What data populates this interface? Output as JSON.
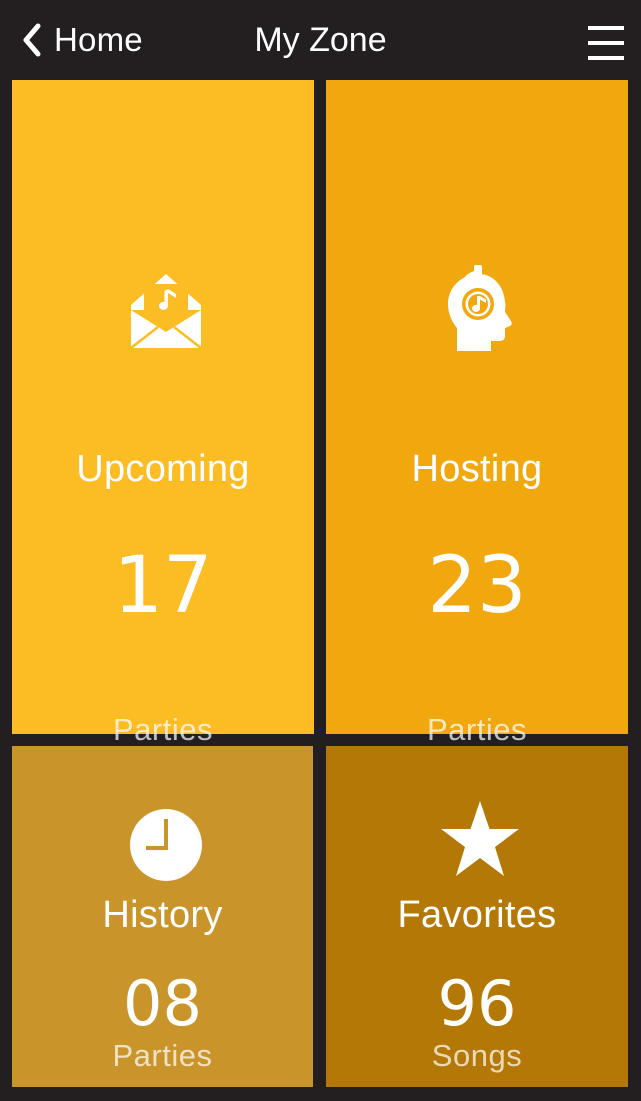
{
  "header": {
    "back_label": "Home",
    "title": "My Zone",
    "back_icon": "chevron-left-icon",
    "menu_icon": "hamburger-menu-icon"
  },
  "tiles": {
    "upcoming": {
      "label": "Upcoming",
      "count": "17",
      "unit": "Parties",
      "icon": "music-envelope-icon",
      "color": "#fcbc24"
    },
    "hosting": {
      "label": "Hosting",
      "count": "23",
      "unit": "Parties",
      "icon": "head-headphones-icon",
      "color": "#f1a80f"
    },
    "history": {
      "label": "History",
      "count": "08",
      "unit": "Parties",
      "icon": "clock-icon",
      "color": "#c9942a"
    },
    "favorites": {
      "label": "Favorites",
      "count": "96",
      "unit": "Songs",
      "icon": "star-icon",
      "color": "#b37806"
    }
  },
  "colors": {
    "background": "#231f20",
    "text": "#ffffff"
  }
}
